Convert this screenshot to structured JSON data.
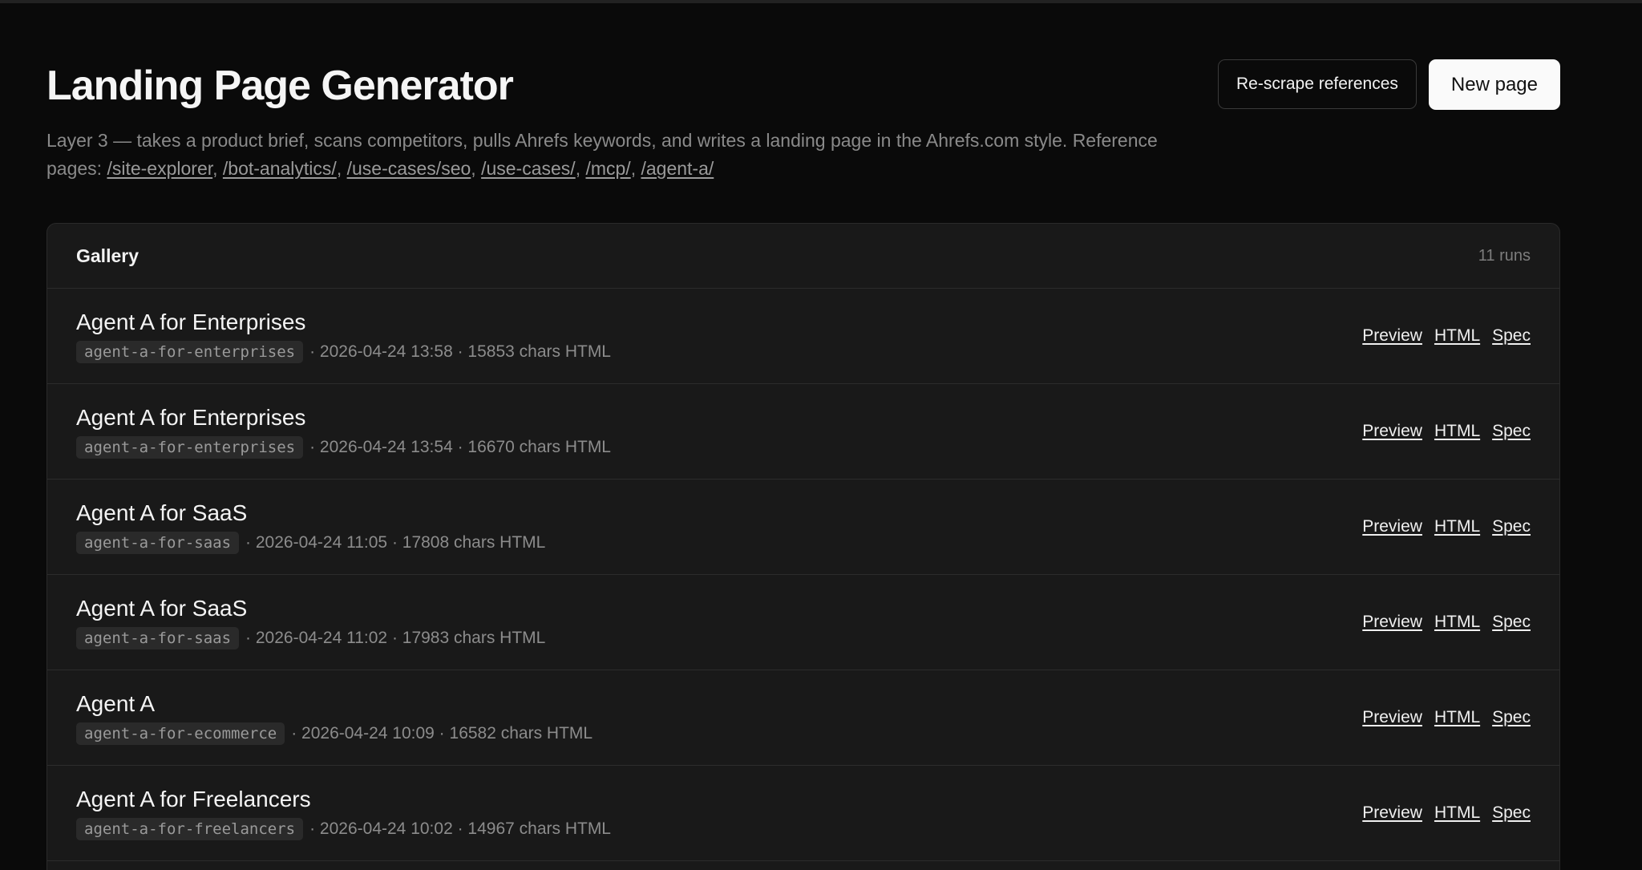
{
  "header": {
    "title": "Landing Page Generator",
    "subtitle_text": "Layer 3 — takes a product brief, scans competitors, pulls Ahrefs keywords, and writes a landing page in the Ahrefs.com style. Reference pages: ",
    "reference_links": [
      "/site-explorer",
      "/bot-analytics/",
      "/use-cases/seo",
      "/use-cases/",
      "/mcp/",
      "/agent-a/"
    ],
    "rescrape_label": "Re-scrape references",
    "new_page_label": "New page"
  },
  "gallery": {
    "title": "Gallery",
    "count": "11 runs",
    "link_labels": {
      "preview": "Preview",
      "html": "HTML",
      "spec": "Spec"
    },
    "rows": [
      {
        "title": "Agent A for Enterprises",
        "slug": "agent-a-for-enterprises",
        "meta": "· 2026-04-24 13:58 · 15853 chars HTML"
      },
      {
        "title": "Agent A for Enterprises",
        "slug": "agent-a-for-enterprises",
        "meta": "· 2026-04-24 13:54 · 16670 chars HTML"
      },
      {
        "title": "Agent A for SaaS",
        "slug": "agent-a-for-saas",
        "meta": "· 2026-04-24 11:05 · 17808 chars HTML"
      },
      {
        "title": "Agent A for SaaS",
        "slug": "agent-a-for-saas",
        "meta": "· 2026-04-24 11:02 · 17983 chars HTML"
      },
      {
        "title": "Agent A",
        "slug": "agent-a-for-ecommerce",
        "meta": "· 2026-04-24 10:09 · 16582 chars HTML"
      },
      {
        "title": "Agent A for Freelancers",
        "slug": "agent-a-for-freelancers",
        "meta": "· 2026-04-24 10:02 · 14967 chars HTML"
      }
    ]
  }
}
